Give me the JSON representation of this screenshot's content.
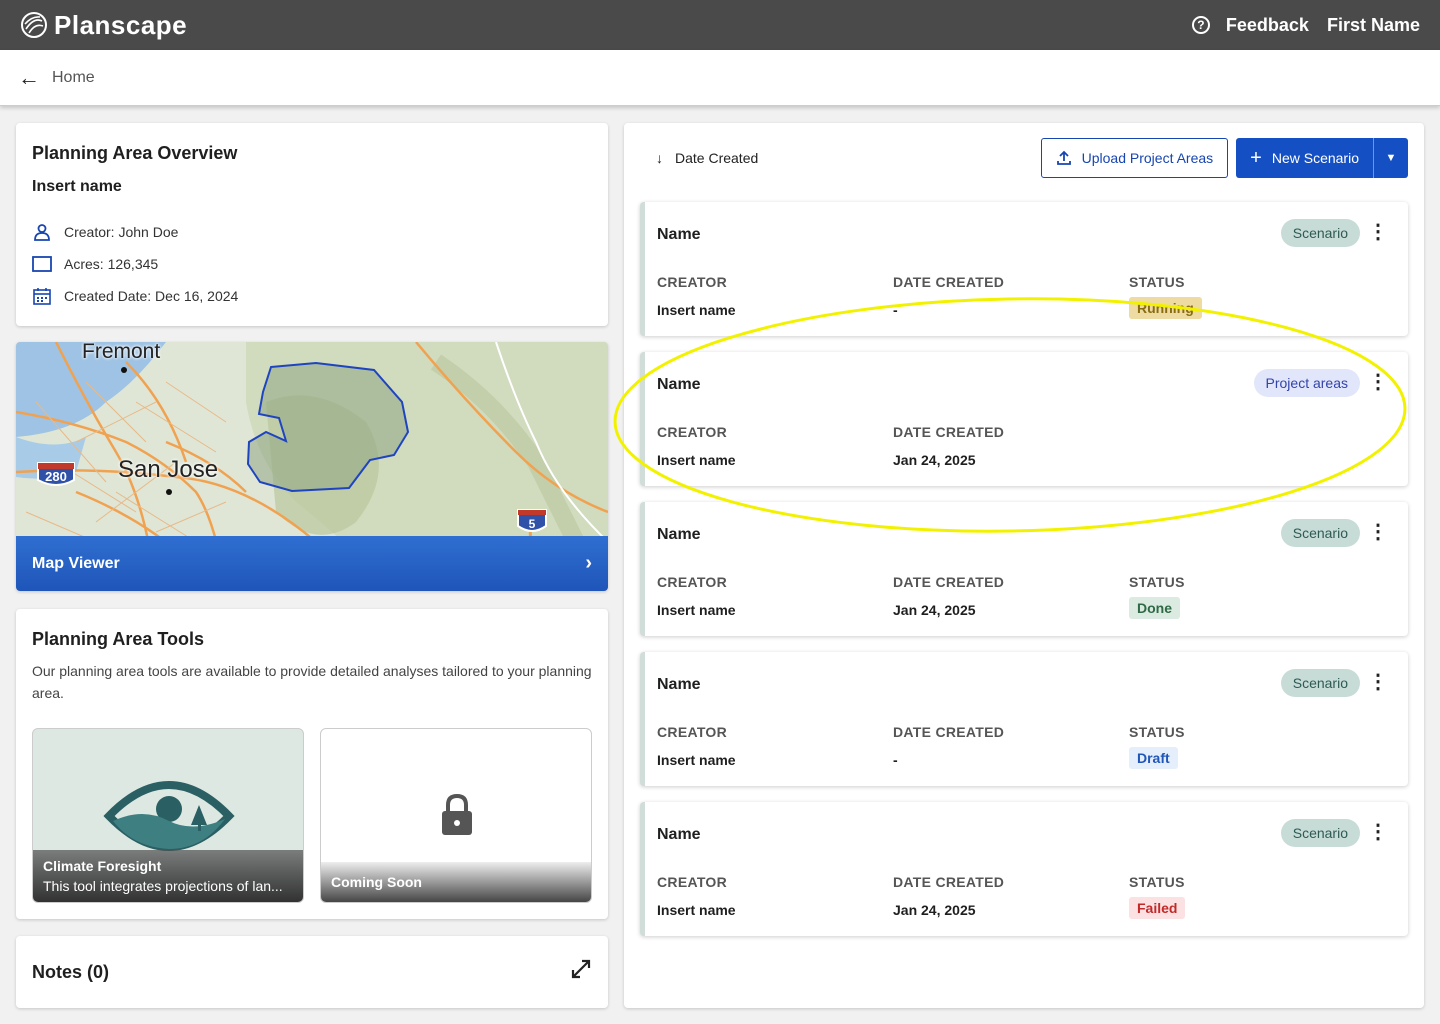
{
  "header": {
    "app_name": "Planscape",
    "feedback_label": "Feedback",
    "user_name": "First Name"
  },
  "breadcrumb": {
    "back_label": "Home"
  },
  "overview": {
    "title": "Planning Area Overview",
    "name": "Insert name",
    "creator": "Creator: John Doe",
    "acres": "Acres: 126,345",
    "created_date": "Created Date: Dec 16, 2024"
  },
  "map": {
    "viewer_label": "Map Viewer",
    "labels": [
      "Fremont",
      "San Jose"
    ],
    "shields": [
      "280",
      "5"
    ]
  },
  "tools": {
    "title": "Planning Area Tools",
    "description": "Our planning area tools are available to provide detailed analyses tailored to your planning area.",
    "items": [
      {
        "title": "Climate Foresight",
        "description": "This tool integrates projections of lan..."
      },
      {
        "title": "Coming Soon"
      }
    ]
  },
  "notes": {
    "title": "Notes (0)"
  },
  "toolbar": {
    "sort_label": "Date Created",
    "upload_label": "Upload Project Areas",
    "new_scenario_label": "New Scenario"
  },
  "columns": {
    "creator": "CREATOR",
    "date_created": "DATE CREATED",
    "status": "STATUS"
  },
  "scenarios": [
    {
      "name": "Name",
      "type": "Scenario",
      "creator": "Insert name",
      "date": "-",
      "status": "Running"
    },
    {
      "name": "Name",
      "type": "Project areas",
      "creator": "Insert name",
      "date": "Jan 24, 2025",
      "status": ""
    },
    {
      "name": "Name",
      "type": "Scenario",
      "creator": "Insert name",
      "date": "Jan 24, 2025",
      "status": "Done"
    },
    {
      "name": "Name",
      "type": "Scenario",
      "creator": "Insert name",
      "date": "-",
      "status": "Draft"
    },
    {
      "name": "Name",
      "type": "Scenario",
      "creator": "Insert name",
      "date": "Jan 24, 2025",
      "status": "Failed"
    }
  ],
  "colors": {
    "primary": "#1450c4",
    "topbar": "#4a4a4a",
    "highlight": "#f2f200"
  }
}
